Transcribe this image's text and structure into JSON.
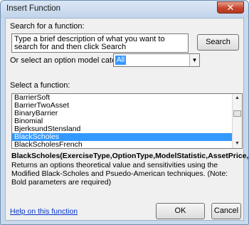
{
  "window": {
    "title": "Insert Function",
    "close_glyph": "✕"
  },
  "search": {
    "label": "Search for a function:",
    "value": "Type a brief description of what you want to search for and then click Search",
    "button": "Search"
  },
  "category": {
    "label": "Or select an option model category:",
    "selected": "All"
  },
  "functions": {
    "label": "Select a function:",
    "items": [
      "BarrierSoft",
      "BarrierTwoAsset",
      "BinaryBarrier",
      "Binomial",
      "BjerksundStensland",
      "BlackScholes",
      "BlackScholesFrench"
    ],
    "selected_index": 5
  },
  "signature": "BlackScholes(ExerciseType,OptionType,ModelStatistic,AssetPrice,(...)",
  "description": "Returns an options theoretical value and sensitivities using the Modified Black-Scholes and Psuedo-American techniques.  (Note: Bold parameters are required)",
  "help_link": "Help on this function",
  "buttons": {
    "ok": "OK",
    "cancel": "Cancel"
  },
  "colors": {
    "selection": "#3399ff",
    "link": "#0033cc",
    "frame": "#c9d9ec",
    "close": "#c7452c"
  }
}
